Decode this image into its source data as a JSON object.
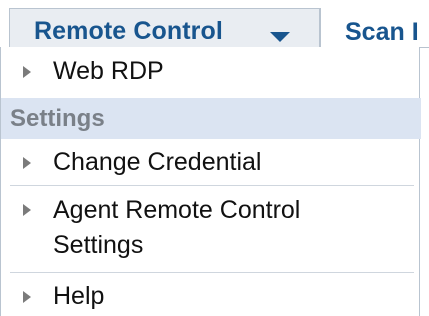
{
  "tabs": [
    {
      "label": "Remote Control"
    },
    {
      "label": "Scan I"
    }
  ],
  "menu": {
    "items_top": [
      {
        "label": "Web RDP"
      }
    ],
    "section_header": "Settings",
    "items_settings": [
      {
        "label": "Change Credential"
      },
      {
        "label_line1": "Agent Remote Control",
        "label_line2": "Settings"
      },
      {
        "label": "Help"
      }
    ]
  }
}
